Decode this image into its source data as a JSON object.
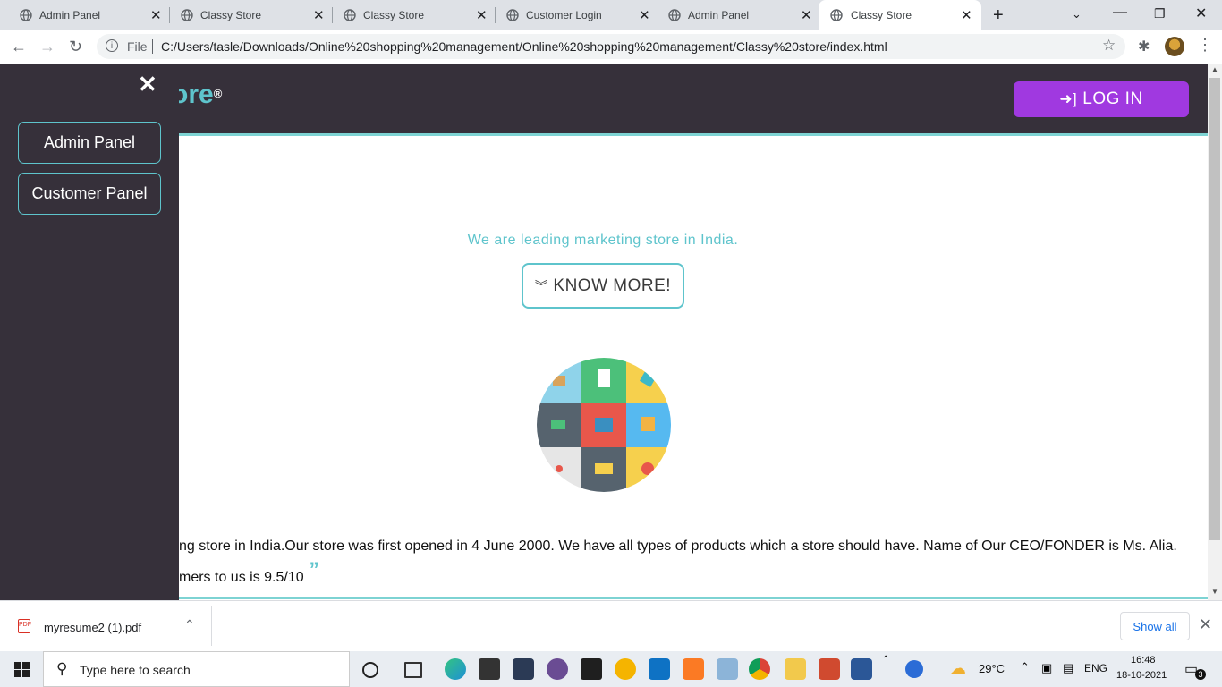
{
  "browser": {
    "tabs": [
      {
        "title": "Admin Panel"
      },
      {
        "title": "Classy Store"
      },
      {
        "title": "Classy Store"
      },
      {
        "title": "Customer Login"
      },
      {
        "title": "Admin Panel"
      },
      {
        "title": "Classy Store",
        "active": true
      }
    ],
    "address": {
      "scheme_label": "File",
      "url": "C:/Users/tasle/Downloads/Online%20shopping%20management/Online%20shopping%20management/Classy%20store/index.html"
    }
  },
  "page": {
    "brand": "ore",
    "brand_mark": "®",
    "login_label": "LOG IN",
    "tagline": "We are leading marketing store in India.",
    "know_more_label": "KNOW MORE!",
    "about_line1": "ng store in India.Our store was first opened in 4 June 2000. We have all types of products which a store should have. Name of Our CEO/FONDER is Ms. Alia.",
    "about_line2": "mers to us is 9.5/10",
    "quote_glyph": "”"
  },
  "sidenav": {
    "close_glyph": "✕",
    "items": [
      {
        "label": "Admin Panel"
      },
      {
        "label": "Customer Panel"
      }
    ]
  },
  "download_bar": {
    "file_name": "myresume2 (1).pdf",
    "show_all_label": "Show all"
  },
  "taskbar": {
    "search_placeholder": "Type here to search",
    "weather_temp": "29°C",
    "language": "ENG",
    "time": "16:48",
    "date": "18-10-2021",
    "notification_count": "3"
  },
  "colors": {
    "accent_teal": "#5ec4cc",
    "login_purple": "#a039e0",
    "header_dark": "#36303a"
  }
}
